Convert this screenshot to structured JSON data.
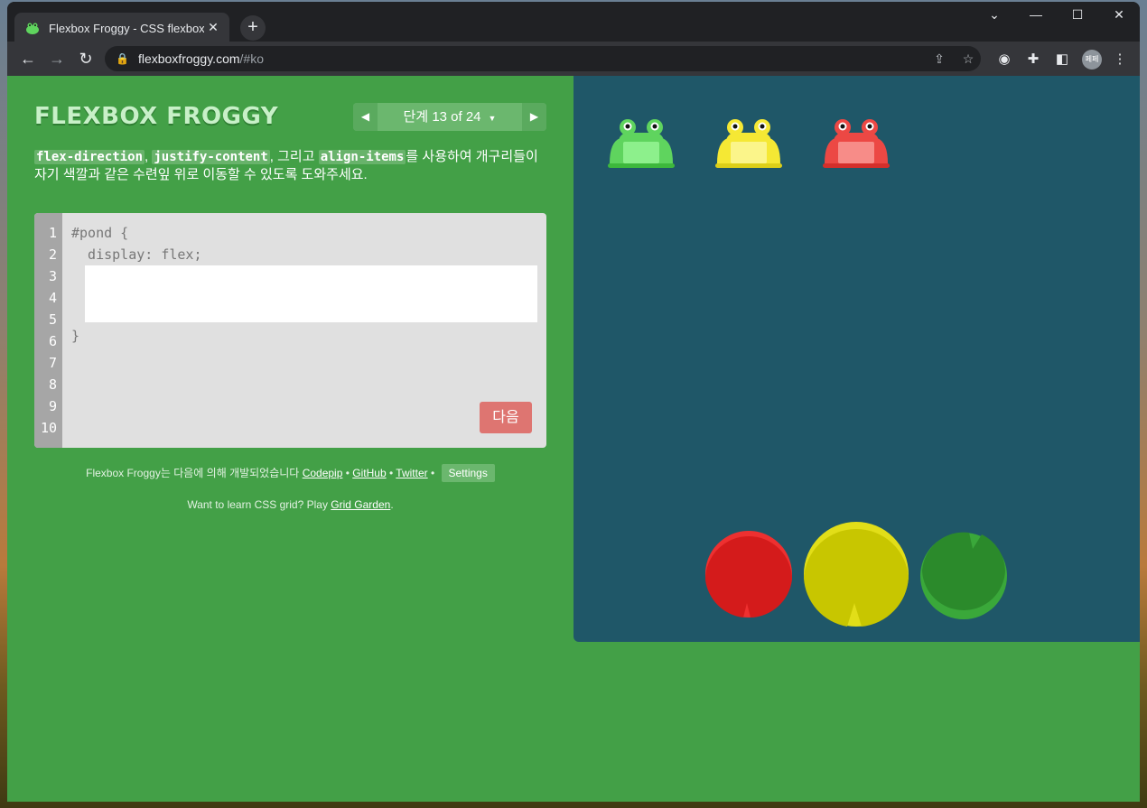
{
  "browser": {
    "tab_title": "Flexbox Froggy - CSS flexbox 속",
    "tab_close": "✕",
    "new_tab": "+",
    "url_host": "flexboxfroggy.com",
    "url_path": "/#ko",
    "profile_initials": "페페"
  },
  "game": {
    "logo": "FLEXBOX FROGGY",
    "level_indicator": "단계 13 of 24",
    "instructions": {
      "code1": "flex-direction",
      "sep1": ", ",
      "code2": "justify-content",
      "sep2": ", 그리고 ",
      "code3": "align-items",
      "rest": "를 사용하여 개구리들이 자기 색깔과 같은 수련잎 위로 이동할 수 있도록 도와주세요."
    },
    "editor": {
      "line_numbers": [
        "1",
        "2",
        "3",
        "4",
        "5",
        "6",
        "7",
        "8",
        "9",
        "10"
      ],
      "line1": "#pond {",
      "line2": "  display: flex;",
      "line6": "}",
      "input_value": "",
      "next_label": "다음"
    },
    "credits": {
      "prefix": "Flexbox Froggy는 다음에 의해 개발되었습니다 ",
      "codepip": "Codepip",
      "github": "GitHub",
      "twitter": "Twitter",
      "bullet": " • ",
      "settings": "Settings"
    },
    "gridgarden": {
      "prefix": "Want to learn CSS grid? Play ",
      "link": "Grid Garden",
      "suffix": "."
    }
  },
  "pond": {
    "frogs": [
      {
        "color": "green",
        "body": "#5fd45e",
        "belly": "#8df08c"
      },
      {
        "color": "yellow",
        "body": "#f5e834",
        "belly": "#fbf58a"
      },
      {
        "color": "red",
        "body": "#ec4844",
        "belly": "#f78c88"
      }
    ],
    "lilypads": [
      {
        "color": "red",
        "main": "#d41b1b",
        "rim": "#ee3030"
      },
      {
        "color": "yellow",
        "main": "#c8c600",
        "rim": "#e2de18"
      },
      {
        "color": "green",
        "main": "#2b8a2b",
        "rim": "#3aa83a"
      }
    ]
  }
}
